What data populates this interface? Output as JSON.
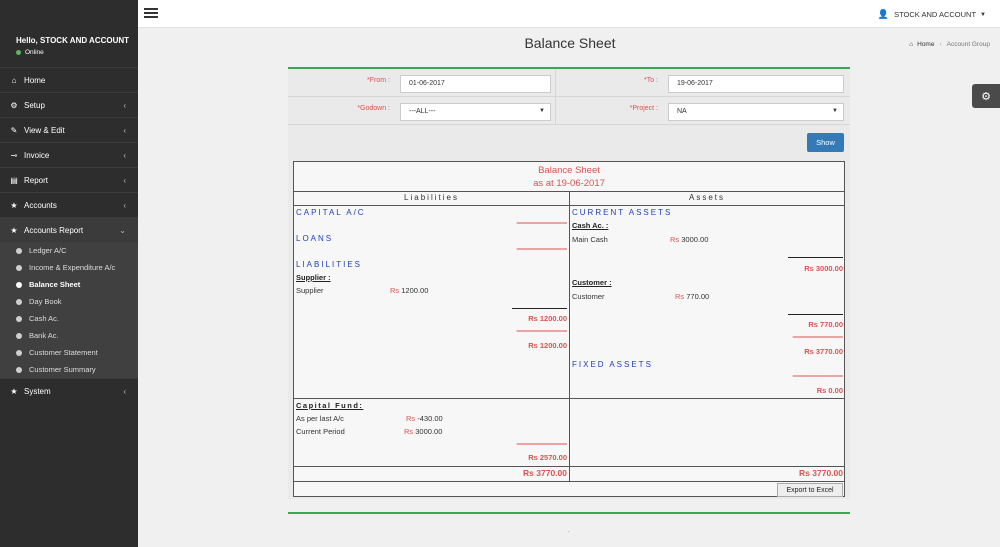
{
  "sidebar": {
    "greeting": "Hello, STOCK AND ACCOUNT",
    "status": "Online",
    "items": [
      {
        "label": "Home",
        "icon": "home-icon",
        "chevron": ""
      },
      {
        "label": "Setup",
        "icon": "cogs-icon",
        "chevron": "‹"
      },
      {
        "label": "View & Edit",
        "icon": "edit-icon",
        "chevron": "‹"
      },
      {
        "label": "Invoice",
        "icon": "plug-icon",
        "chevron": "‹"
      },
      {
        "label": "Report",
        "icon": "report-icon",
        "chevron": "‹"
      },
      {
        "label": "Accounts",
        "icon": "star-icon",
        "chevron": "‹"
      },
      {
        "label": "Accounts Report",
        "icon": "star-icon",
        "chevron": "⌄"
      },
      {
        "label": "System",
        "icon": "star-icon",
        "chevron": "‹"
      }
    ],
    "subitems": [
      {
        "label": "Ledger A/C"
      },
      {
        "label": "Income & Expenditure A/c"
      },
      {
        "label": "Balance Sheet"
      },
      {
        "label": "Day Book"
      },
      {
        "label": "Cash Ac."
      },
      {
        "label": "Bank Ac."
      },
      {
        "label": "Customer Statement"
      },
      {
        "label": "Customer Summary"
      }
    ]
  },
  "topbar": {
    "user_label": "STOCK AND ACCOUNT"
  },
  "page": {
    "title": "Balance Sheet"
  },
  "breadcrumb": {
    "home": "Home",
    "current": "Account Group"
  },
  "filters": {
    "from_label": "*From :",
    "from_value": "01-06-2017",
    "to_label": "*To :",
    "to_value": "19-06-2017",
    "godown_label": "*Godown :",
    "godown_value": "---ALL---",
    "project_label": "*Project :",
    "project_value": "NA",
    "show_label": "Show"
  },
  "report": {
    "title": "Balance Sheet",
    "subtitle": "as at 19-06-2017",
    "liabilities_header": "Liabilities",
    "assets_header": "Assets",
    "currency": "Rs",
    "liabilities": {
      "capital_ac": "CAPITAL A/C",
      "loans": "LOANS",
      "liabilities": "LIABILITIES",
      "supplier_group": "Supplier :",
      "supplier_name": "Supplier",
      "supplier_amount": "1200.00",
      "sub_total": "Rs 1200.00",
      "group_total": "Rs 1200.00",
      "capital_fund": "Capital Fund:",
      "as_per_last": "As per last A/c",
      "as_per_last_amount": "-430.00",
      "current_period": "Current Period",
      "current_period_amount": "3000.00",
      "capital_total": "Rs 2570.00",
      "grand_total": "Rs 3770.00"
    },
    "assets": {
      "current_assets": "CURRENT ASSETS",
      "cash_group": "Cash Ac. :",
      "main_cash": "Main Cash",
      "main_cash_amount": "3000.00",
      "cash_total": "Rs 3000.00",
      "customer_group": "Customer :",
      "customer_name": "Customer",
      "customer_amount": "770.00",
      "customer_total": "Rs 770.00",
      "current_total": "Rs 3770.00",
      "fixed_assets": "FIXED ASSETS",
      "fixed_total": "Rs 0.00",
      "grand_total": "Rs 3770.00"
    },
    "export_label": "Export to Excel",
    "footer_dot": "."
  },
  "colors": {
    "accent_green": "#3aa757",
    "red": "#d9534f",
    "blue": "#2240b8",
    "button_blue": "#337ab7",
    "sidebar": "#2d2d2d"
  }
}
